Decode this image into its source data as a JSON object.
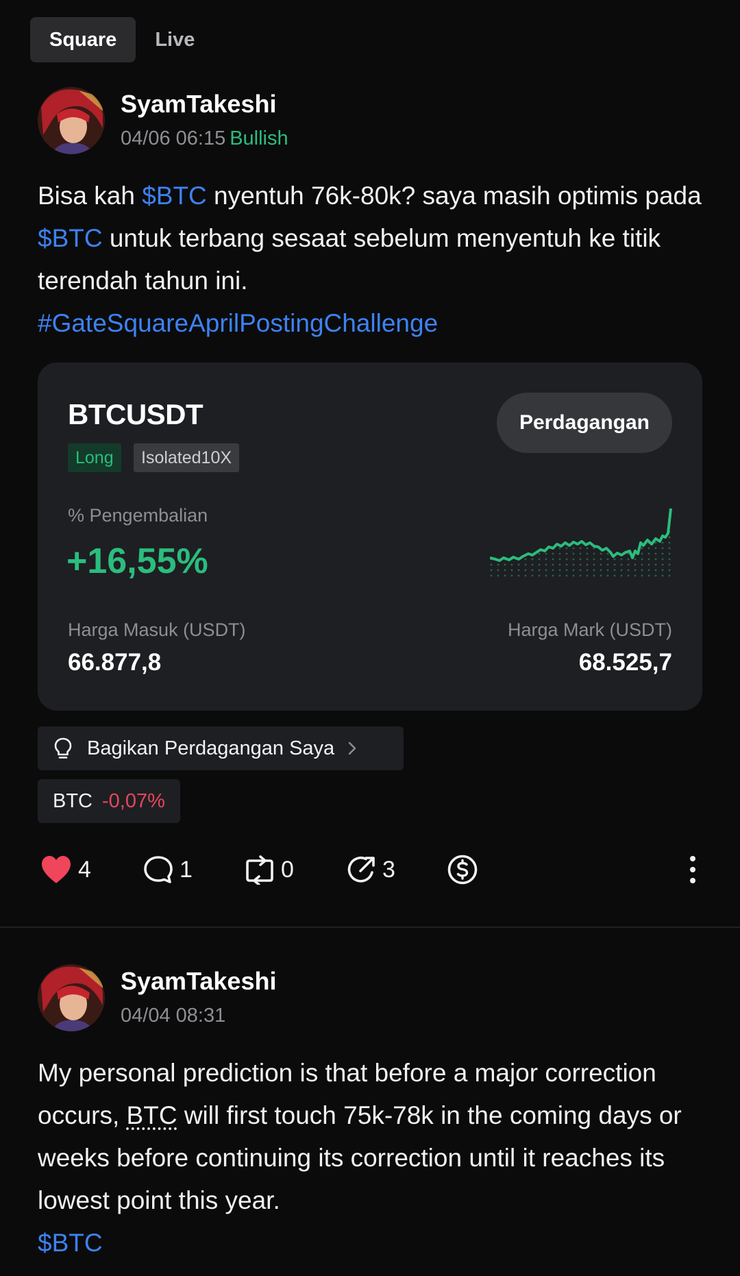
{
  "tabs": [
    {
      "label": "Square",
      "active": true
    },
    {
      "label": "Live",
      "active": false
    }
  ],
  "posts": [
    {
      "author": "SyamTakeshi",
      "time": "04/06 06:15",
      "sentiment": "Bullish",
      "text": {
        "t1": "Bisa kah ",
        "l1": "$BTC",
        "t2": " nyentuh 76k-80k? saya masih optimis pada ",
        "l2": "$BTC",
        "t3": " untuk terbang sesaat sebelum menyentuh ke titik terendah tahun ini.",
        "tag": "#GateSquareAprilPostingChallenge"
      },
      "trade_card": {
        "pair": "BTCUSDT",
        "button": "Perdagangan",
        "side": "Long",
        "margin": "Isolated10X",
        "return_label": "% Pengembalian",
        "return_value": "+16,55%",
        "entry_label": "Harga Masuk (USDT)",
        "entry_value": "66.877,8",
        "mark_label": "Harga Mark (USDT)",
        "mark_value": "68.525,7",
        "sparkline_color": "#2bbd7e"
      },
      "share_label": "Bagikan Perdagangan Saya",
      "ticker": {
        "symbol": "BTC",
        "change": "-0,07%"
      },
      "actions": {
        "likes": "4",
        "comments": "1",
        "reposts": "0",
        "shares": "3"
      }
    },
    {
      "author": "SyamTakeshi",
      "time": "04/04 08:31",
      "text": {
        "t1": "My personal prediction is that before a major correction occurs, ",
        "btc": "BTC",
        "t2": " will first touch 75k-78k in the coming days or weeks before continuing its correction until it reaches its lowest point this year.",
        "l1": "$BTC"
      }
    }
  ],
  "colors": {
    "background": "#0b0b0c",
    "green": "#2bbd7e",
    "red": "#e6465f",
    "link": "#3d82f2",
    "heart": "#f0455a"
  }
}
